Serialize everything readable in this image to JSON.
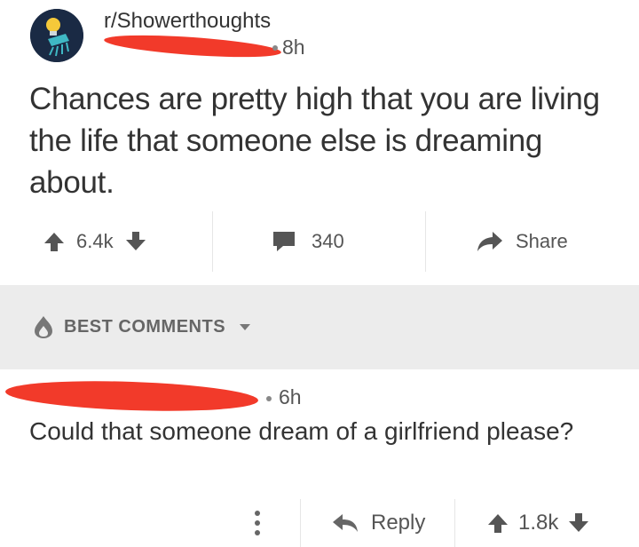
{
  "post": {
    "subreddit": "r/Showerthoughts",
    "age": "8h",
    "title": "Chances are pretty high that you are living the life that someone else is dreaming about.",
    "upvotes": "6.4k",
    "comments_count": "340",
    "share_label": "Share"
  },
  "comments_section": {
    "sort_label": "BEST COMMENTS"
  },
  "comment": {
    "age": "6h",
    "body": "Could that someone dream of a girlfriend please?",
    "reply_label": "Reply",
    "score": "1.8k"
  },
  "colors": {
    "redaction": "#f23a2a",
    "text": "#333333",
    "muted": "#555555",
    "band": "#ececec"
  },
  "icons": [
    "lightbulb-shower-icon",
    "upvote-icon",
    "downvote-icon",
    "comment-bubble-icon",
    "share-arrow-icon",
    "flame-icon",
    "chevron-down-icon",
    "more-vertical-icon",
    "reply-arrow-icon"
  ]
}
